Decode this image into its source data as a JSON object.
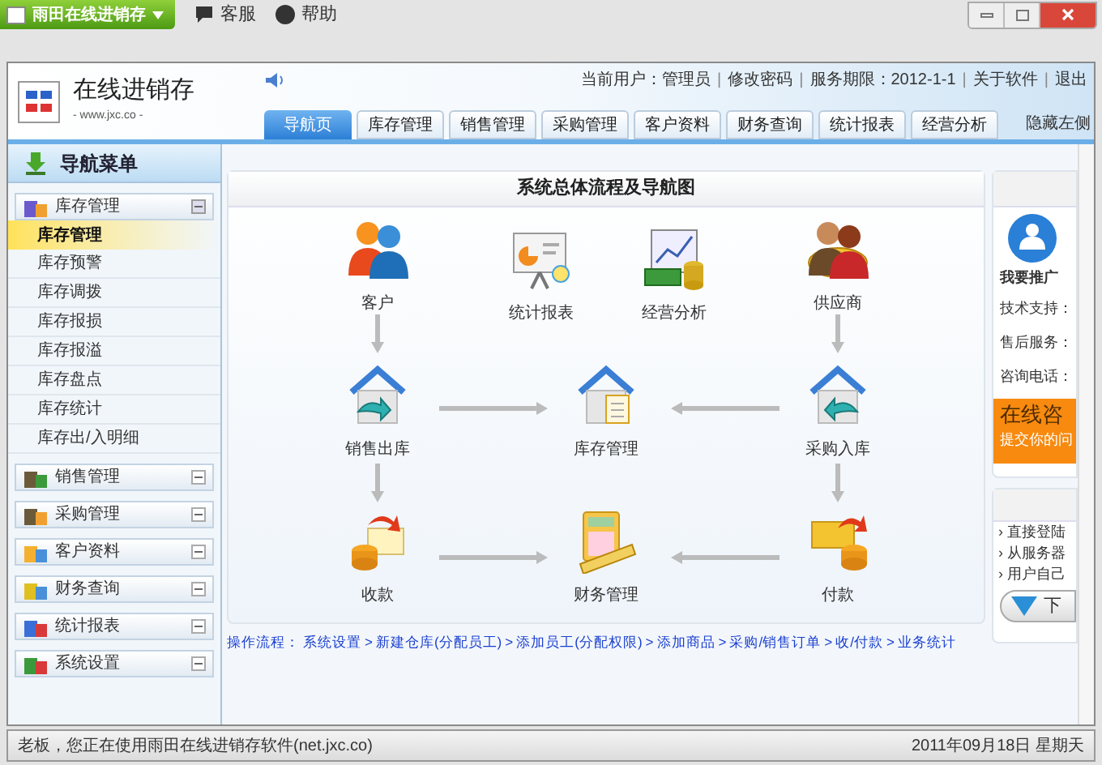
{
  "window": {
    "app_title": "雨田在线进销存",
    "menu": [
      "客服",
      "帮助"
    ]
  },
  "header": {
    "logo_title": "在线进销存",
    "logo_subtitle": "- www.jxc.co -",
    "user_label": "当前用户：",
    "user": "管理员",
    "links": [
      "修改密码",
      "服务期限：2012-1-1",
      "关于软件",
      "退出"
    ],
    "hide_left": "隐藏左侧",
    "separator": "|"
  },
  "tabs": [
    {
      "label": "导航页",
      "selected": true
    },
    {
      "label": "库存管理",
      "selected": false
    },
    {
      "label": "销售管理",
      "selected": false
    },
    {
      "label": "采购管理",
      "selected": false
    },
    {
      "label": "客户资料",
      "selected": false
    },
    {
      "label": "财务查询",
      "selected": false
    },
    {
      "label": "统计报表",
      "selected": false
    },
    {
      "label": "经营分析",
      "selected": false
    }
  ],
  "sidebar": {
    "title": "导航菜单",
    "groups": [
      {
        "label": "库存管理",
        "expanded": true,
        "items": [
          {
            "label": "库存管理",
            "selected": true
          },
          {
            "label": "库存预警",
            "selected": false
          },
          {
            "label": "库存调拨",
            "selected": false
          },
          {
            "label": "库存报损",
            "selected": false
          },
          {
            "label": "库存报溢",
            "selected": false
          },
          {
            "label": "库存盘点",
            "selected": false
          },
          {
            "label": "库存统计",
            "selected": false
          },
          {
            "label": "库存出/入明细",
            "selected": false
          }
        ]
      },
      {
        "label": "销售管理",
        "expanded": false
      },
      {
        "label": "采购管理",
        "expanded": false
      },
      {
        "label": "客户资料",
        "expanded": false
      },
      {
        "label": "财务查询",
        "expanded": false
      },
      {
        "label": "统计报表",
        "expanded": false
      },
      {
        "label": "系统设置",
        "expanded": false
      }
    ]
  },
  "flow_panel": {
    "title": "系统总体流程及导航图",
    "nodes": [
      {
        "label": "客户"
      },
      {
        "label": "统计报表"
      },
      {
        "label": "经营分析"
      },
      {
        "label": "供应商"
      },
      {
        "label": "销售出库"
      },
      {
        "label": "库存管理"
      },
      {
        "label": "采购入库"
      },
      {
        "label": "收款"
      },
      {
        "label": "财务管理"
      },
      {
        "label": "付款"
      }
    ]
  },
  "op_flow": {
    "label": "操作流程：",
    "separator": ">",
    "steps": [
      "系统设置",
      "新建仓库(分配员工)",
      "添加员工(分配权限)",
      "添加商品",
      "采购/销售订单",
      "收/付款",
      "业务统计"
    ]
  },
  "side_panel": {
    "promo": "我要推广",
    "fields": [
      "技术支持：",
      "售后服务：",
      "咨询电话："
    ],
    "consult_title": "在线咨",
    "consult_text": "提交你的问",
    "bullet": "›",
    "list": [
      "直接登陆",
      "从服务器",
      "用户自己"
    ],
    "download": "下"
  },
  "status_bar": {
    "message": "老板，您正在使用雨田在线进销存软件(net.jxc.co)",
    "date": "2011年09月18日 星期天"
  }
}
